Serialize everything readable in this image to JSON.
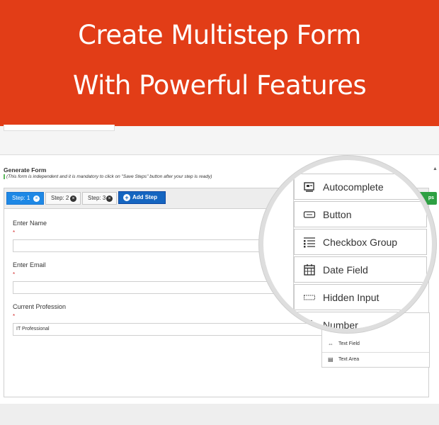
{
  "banner": {
    "line1": "Create Multistep Form",
    "line2": "With Powerful Features",
    "background": "#e23d17"
  },
  "panel": {
    "title": "Generate Form",
    "note": "(This form is independent and it is mandatory to click on \"Save Steps\" button after your step is ready)"
  },
  "tabs": [
    {
      "label": "Step: 1",
      "active": true
    },
    {
      "label": "Step: 2",
      "active": false
    },
    {
      "label": "Step: 3",
      "active": false
    }
  ],
  "add_step_label": "Add Step",
  "save_steps_label": "ps",
  "fields": [
    {
      "label": "Enter Name",
      "required_mark": "*",
      "value": ""
    },
    {
      "label": "Enter Email",
      "required_mark": "*",
      "value": ""
    },
    {
      "label": "Current Profession",
      "required_mark": "*",
      "value": "IT Professional"
    }
  ],
  "palette_items": [
    {
      "icon": "text-field-icon",
      "label": "Text Field"
    },
    {
      "icon": "text-area-icon",
      "label": "Text Area"
    }
  ],
  "magnifier_items": [
    {
      "icon": "autocomplete-icon",
      "label": "Autocomplete"
    },
    {
      "icon": "button-icon",
      "label": "Button"
    },
    {
      "icon": "checkbox-group-icon",
      "label": "Checkbox Group"
    },
    {
      "icon": "date-field-icon",
      "label": "Date Field"
    },
    {
      "icon": "hidden-input-icon",
      "label": "Hidden Input"
    },
    {
      "icon": "number-icon",
      "label": "Number"
    }
  ],
  "colors": {
    "tab_active": "#1e88e5",
    "add_step": "#1565c0",
    "save_steps": "#2ea043",
    "required": "#d32f2f"
  }
}
